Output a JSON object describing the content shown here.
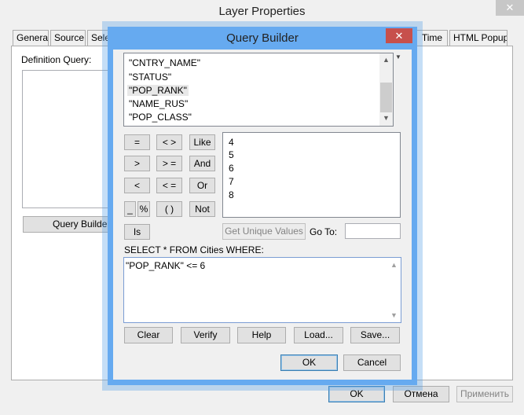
{
  "window": {
    "title": "Layer Properties",
    "close_label": "✕"
  },
  "tabs": [
    {
      "label": "General"
    },
    {
      "label": "Source"
    },
    {
      "label": "Selec"
    },
    {
      "label": "Time"
    },
    {
      "label": "HTML Popup"
    }
  ],
  "definition": {
    "label": "Definition Query:",
    "query_builder_button": "Query Builder..."
  },
  "footer": {
    "ok": "OK",
    "cancel": "Отмена",
    "apply": "Применить"
  },
  "query_builder": {
    "title": "Query Builder",
    "close_label": "✕",
    "fields": [
      "\"CNTRY_NAME\"",
      "\"STATUS\"",
      "\"POP_RANK\"",
      "\"NAME_RUS\"",
      "\"POP_CLASS\""
    ],
    "selected_field": "\"POP_RANK\"",
    "operators": {
      "eq": "=",
      "ne": "< >",
      "like": "Like",
      "gt": ">",
      "ge": "> =",
      "and": "And",
      "lt": "<",
      "le": "< =",
      "or": "Or",
      "underscore": "_",
      "percent": "%",
      "parens": "( )",
      "not": "Not",
      "is": "Is"
    },
    "values": [
      "4",
      "5",
      "6",
      "7",
      "8"
    ],
    "get_unique_values": "Get Unique Values",
    "goto_label": "Go To:",
    "goto_value": "",
    "select_label": "SELECT * FROM Cities WHERE:",
    "where_clause": "\"POP_RANK\" <= 6",
    "actions": {
      "clear": "Clear",
      "verify": "Verify",
      "help": "Help",
      "load": "Load...",
      "save": "Save..."
    },
    "ok": "OK",
    "cancel": "Cancel"
  },
  "colors": {
    "dialog_frame": "#66aaf0",
    "close_button": "#c7504c",
    "panel": "#f0f0f0"
  }
}
